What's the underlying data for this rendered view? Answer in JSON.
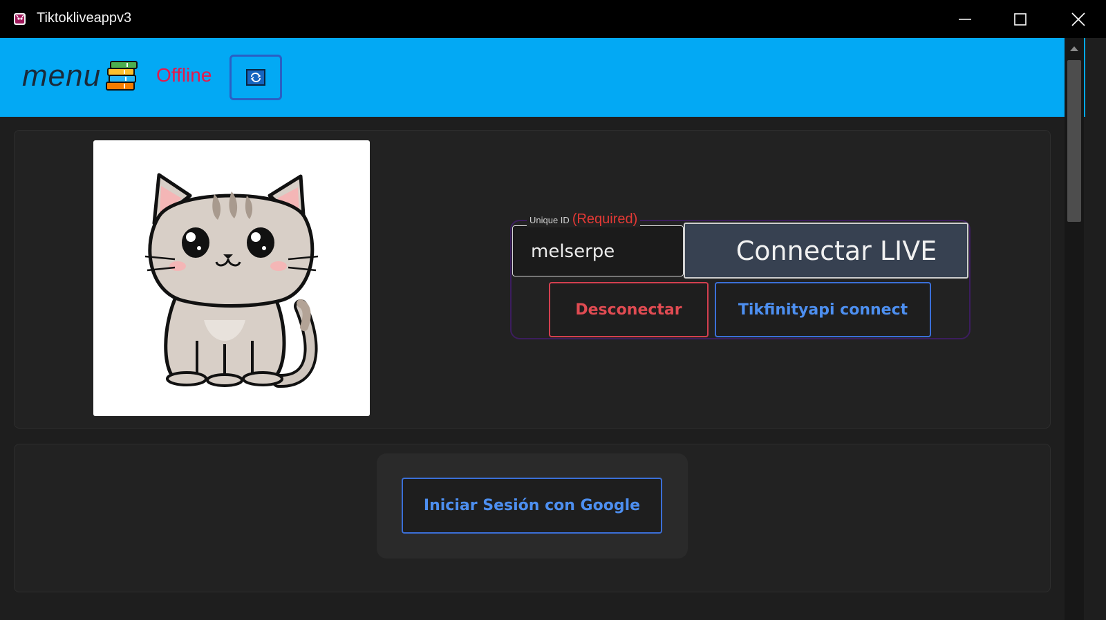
{
  "window": {
    "title": "Tiktokliveappv3",
    "app_icon": "tiktok-live-app-icon",
    "controls": [
      "minimize-icon",
      "maximize-icon",
      "close-icon"
    ]
  },
  "header": {
    "menu_label": "menu",
    "menu_icon": "books-icon",
    "status": "Offline",
    "refresh_icon": "refresh-icon",
    "background_color": "#03a9f4",
    "status_color": "#e8184a"
  },
  "profile": {
    "avatar": "cat-avatar"
  },
  "connect": {
    "field_label": "Unique ID",
    "field_required": "(Required)",
    "unique_id_value": "melserpe",
    "connect_live_label": "Connectar LIVE",
    "disconnect_label": "Desconectar",
    "tikfinity_label": "Tikfinityapi connect"
  },
  "login": {
    "google_label": "Iniciar Sesión con Google"
  },
  "colors": {
    "background": "#1e1e1e",
    "panel": "#222222",
    "accent_blue": "#4d8ff0",
    "accent_red": "#e04b52"
  }
}
